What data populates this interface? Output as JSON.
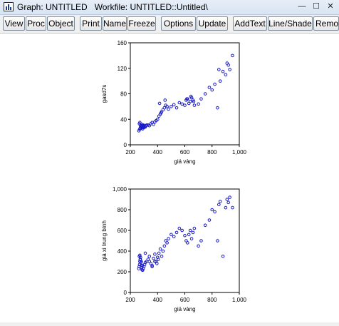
{
  "window": {
    "title": "Graph: UNTITLED   Workfile: UNTITLED::Untitled\\",
    "buttons": {
      "minimize": "—",
      "maximize": "☐",
      "close": "✕"
    }
  },
  "toolbar": {
    "buttons": [
      "View",
      "Proc",
      "Object",
      "Print",
      "Name",
      "Freeze",
      "Options",
      "Update",
      "AddText",
      "Line/Shade",
      "Remo"
    ]
  },
  "colors": {
    "marker": "#1a1ac8"
  },
  "chart_data": [
    {
      "type": "scatter",
      "xlabel": "giá vàng",
      "ylabel": "gasd7s",
      "xlim": [
        200,
        1000
      ],
      "ylim": [
        0,
        160
      ],
      "xticks": [
        "200",
        "400",
        "600",
        "800",
        "1,000"
      ],
      "yticks": [
        "0",
        "40",
        "80",
        "120",
        "160"
      ],
      "x": [
        262,
        268,
        272,
        276,
        280,
        284,
        288,
        292,
        296,
        300,
        305,
        310,
        315,
        320,
        266,
        274,
        282,
        290,
        298,
        306,
        330,
        340,
        350,
        360,
        370,
        380,
        390,
        400,
        410,
        420,
        425,
        430,
        440,
        450,
        460,
        470,
        480,
        500,
        520,
        540,
        560,
        580,
        600,
        610,
        620,
        630,
        640,
        650,
        660,
        670,
        700,
        720,
        750,
        780,
        800,
        820,
        840,
        850,
        860,
        880,
        900,
        910,
        920,
        930,
        950,
        270,
        285,
        300,
        415,
        455,
        615,
        645,
        665
      ],
      "y": [
        22,
        24,
        26,
        28,
        27,
        30,
        28,
        29,
        31,
        27,
        29,
        28,
        30,
        31,
        33,
        30,
        26,
        25,
        27,
        29,
        31,
        30,
        33,
        35,
        32,
        36,
        38,
        40,
        45,
        48,
        50,
        52,
        55,
        58,
        62,
        60,
        56,
        60,
        63,
        58,
        66,
        64,
        62,
        70,
        72,
        65,
        68,
        74,
        70,
        62,
        64,
        72,
        80,
        90,
        86,
        95,
        58,
        118,
        100,
        115,
        110,
        128,
        125,
        118,
        140,
        35,
        32,
        30,
        65,
        70,
        72,
        76,
        68
      ]
    },
    {
      "type": "scatter",
      "xlabel": "giá vàng",
      "ylabel": "giá xi trung bình",
      "xlim": [
        200,
        1000
      ],
      "ylim": [
        0,
        1000
      ],
      "xticks": [
        "200",
        "400",
        "600",
        "800",
        "1,000"
      ],
      "yticks": [
        "0",
        "200",
        "400",
        "600",
        "800",
        "1,000"
      ],
      "x": [
        262,
        265,
        268,
        270,
        272,
        275,
        278,
        280,
        283,
        286,
        290,
        295,
        300,
        305,
        310,
        266,
        270,
        274,
        280,
        288,
        320,
        330,
        340,
        350,
        360,
        370,
        380,
        390,
        400,
        410,
        420,
        430,
        440,
        450,
        460,
        470,
        480,
        500,
        520,
        540,
        560,
        580,
        600,
        610,
        620,
        630,
        640,
        650,
        660,
        670,
        700,
        720,
        750,
        780,
        800,
        820,
        840,
        850,
        860,
        880,
        900,
        910,
        920,
        930,
        950,
        380,
        395,
        405,
        310,
        340,
        360
      ],
      "y": [
        230,
        250,
        270,
        300,
        320,
        340,
        290,
        260,
        240,
        220,
        215,
        230,
        250,
        270,
        290,
        350,
        360,
        320,
        300,
        260,
        300,
        320,
        350,
        280,
        250,
        330,
        370,
        300,
        340,
        380,
        420,
        350,
        400,
        450,
        500,
        480,
        520,
        560,
        540,
        580,
        620,
        600,
        550,
        500,
        480,
        560,
        600,
        520,
        580,
        620,
        450,
        500,
        650,
        700,
        800,
        780,
        500,
        850,
        880,
        350,
        820,
        900,
        870,
        920,
        820,
        300,
        280,
        320,
        380,
        300,
        260
      ]
    }
  ]
}
